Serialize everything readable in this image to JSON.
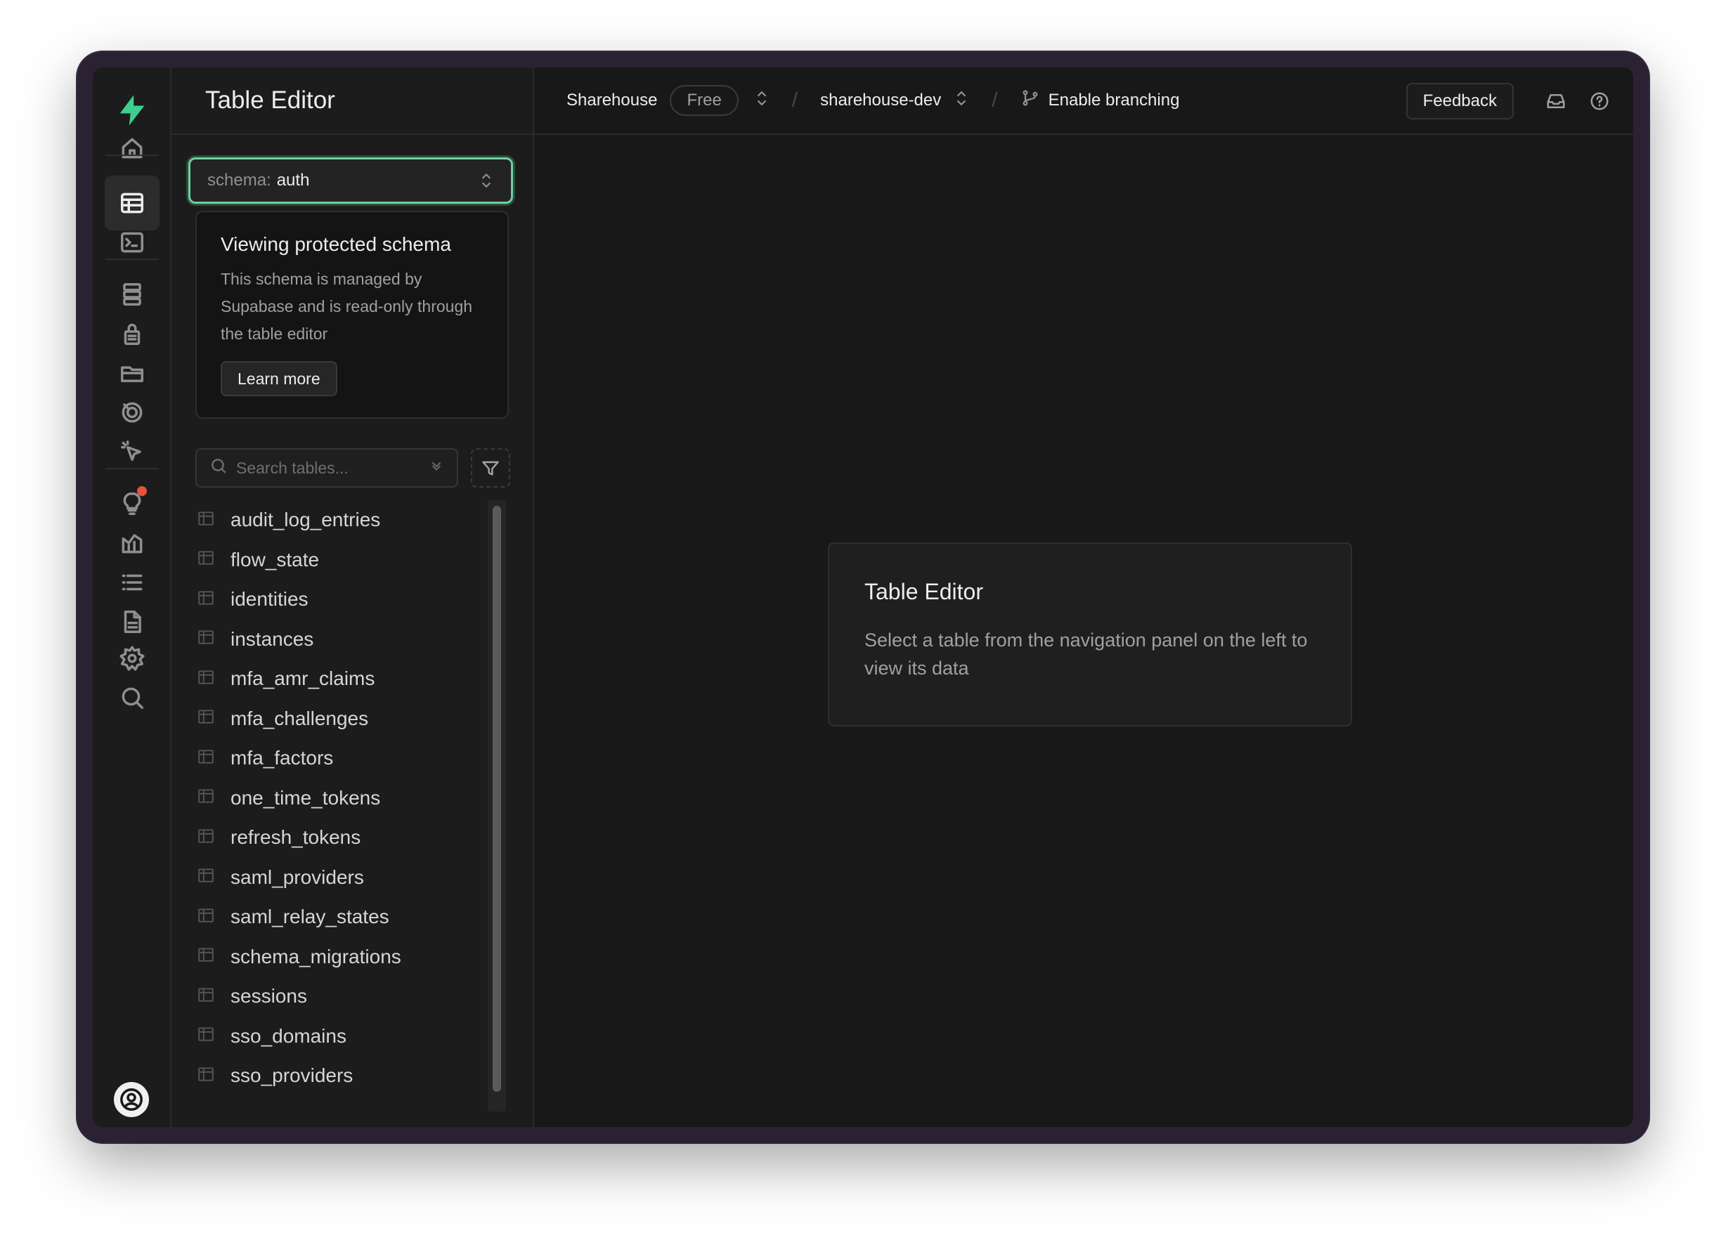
{
  "sidebar_panel": {
    "title": "Table Editor",
    "schema_label": "schema:",
    "schema_value": "auth"
  },
  "notice": {
    "title": "Viewing protected schema",
    "body": "This schema is managed by Supabase and is read-only through the table editor",
    "button": "Learn more"
  },
  "search": {
    "placeholder": "Search tables..."
  },
  "tables": [
    "audit_log_entries",
    "flow_state",
    "identities",
    "instances",
    "mfa_amr_claims",
    "mfa_challenges",
    "mfa_factors",
    "one_time_tokens",
    "refresh_tokens",
    "saml_providers",
    "saml_relay_states",
    "schema_migrations",
    "sessions",
    "sso_domains",
    "sso_providers"
  ],
  "topbar": {
    "org": "Sharehouse",
    "plan": "Free",
    "project": "sharehouse-dev",
    "branching": "Enable branching",
    "feedback": "Feedback"
  },
  "empty_state": {
    "title": "Table Editor",
    "body": "Select a table from the navigation panel on the left to view its data"
  },
  "colors": {
    "accent": "#6ccfa1",
    "notification": "#e5533d",
    "background": "#181818"
  },
  "rail_icons": [
    "logo-icon",
    "home-icon",
    "table-editor-icon",
    "sql-editor-icon",
    "database-icon",
    "auth-icon",
    "storage-icon",
    "realtime-icon",
    "edge-functions-icon",
    "advisors-icon",
    "reports-icon",
    "logs-icon",
    "api-docs-icon",
    "settings-icon",
    "search-icon",
    "user-avatar-icon"
  ]
}
